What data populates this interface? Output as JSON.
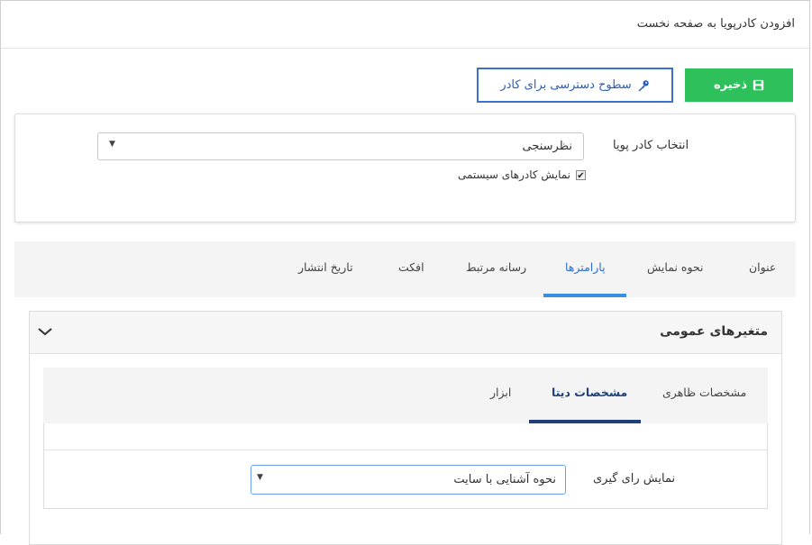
{
  "header": {
    "title": "افزودن کادرپویا به صفحه نخست"
  },
  "toolbar": {
    "save_label": "ذخیره",
    "access_label": "سطوح دسترسی برای کادر",
    "save_color": "#2ec05a",
    "access_border_color": "#3b6fd0"
  },
  "selector": {
    "label": "انتخاب کادر پویا",
    "value": "نظرسنجی",
    "show_system_label": "نمایش کادرهای سیستمی",
    "show_system_checked": true
  },
  "main_tabs": [
    {
      "label": "عنوان",
      "active": false
    },
    {
      "label": "نحوه نمایش",
      "active": false
    },
    {
      "label": "پارامترها",
      "active": true
    },
    {
      "label": "رسانه مرتبط",
      "active": false
    },
    {
      "label": "افکت",
      "active": false
    },
    {
      "label": "تاریخ انتشار",
      "active": false
    }
  ],
  "panel": {
    "title": "متغیرهای عمومی",
    "sub_tabs": [
      {
        "label": "مشخصات ظاهری",
        "active": false
      },
      {
        "label": "مشخصات دیتا",
        "active": true
      },
      {
        "label": "ابزار",
        "active": false
      }
    ],
    "field": {
      "label": "نمایش رای گیری",
      "value": "نحوه آشنایی با سایت"
    }
  },
  "icons": {
    "save": "floppy-disk-icon",
    "access": "key-icon",
    "chevron": "chevron-down-icon",
    "caret": "caret-down-icon"
  }
}
